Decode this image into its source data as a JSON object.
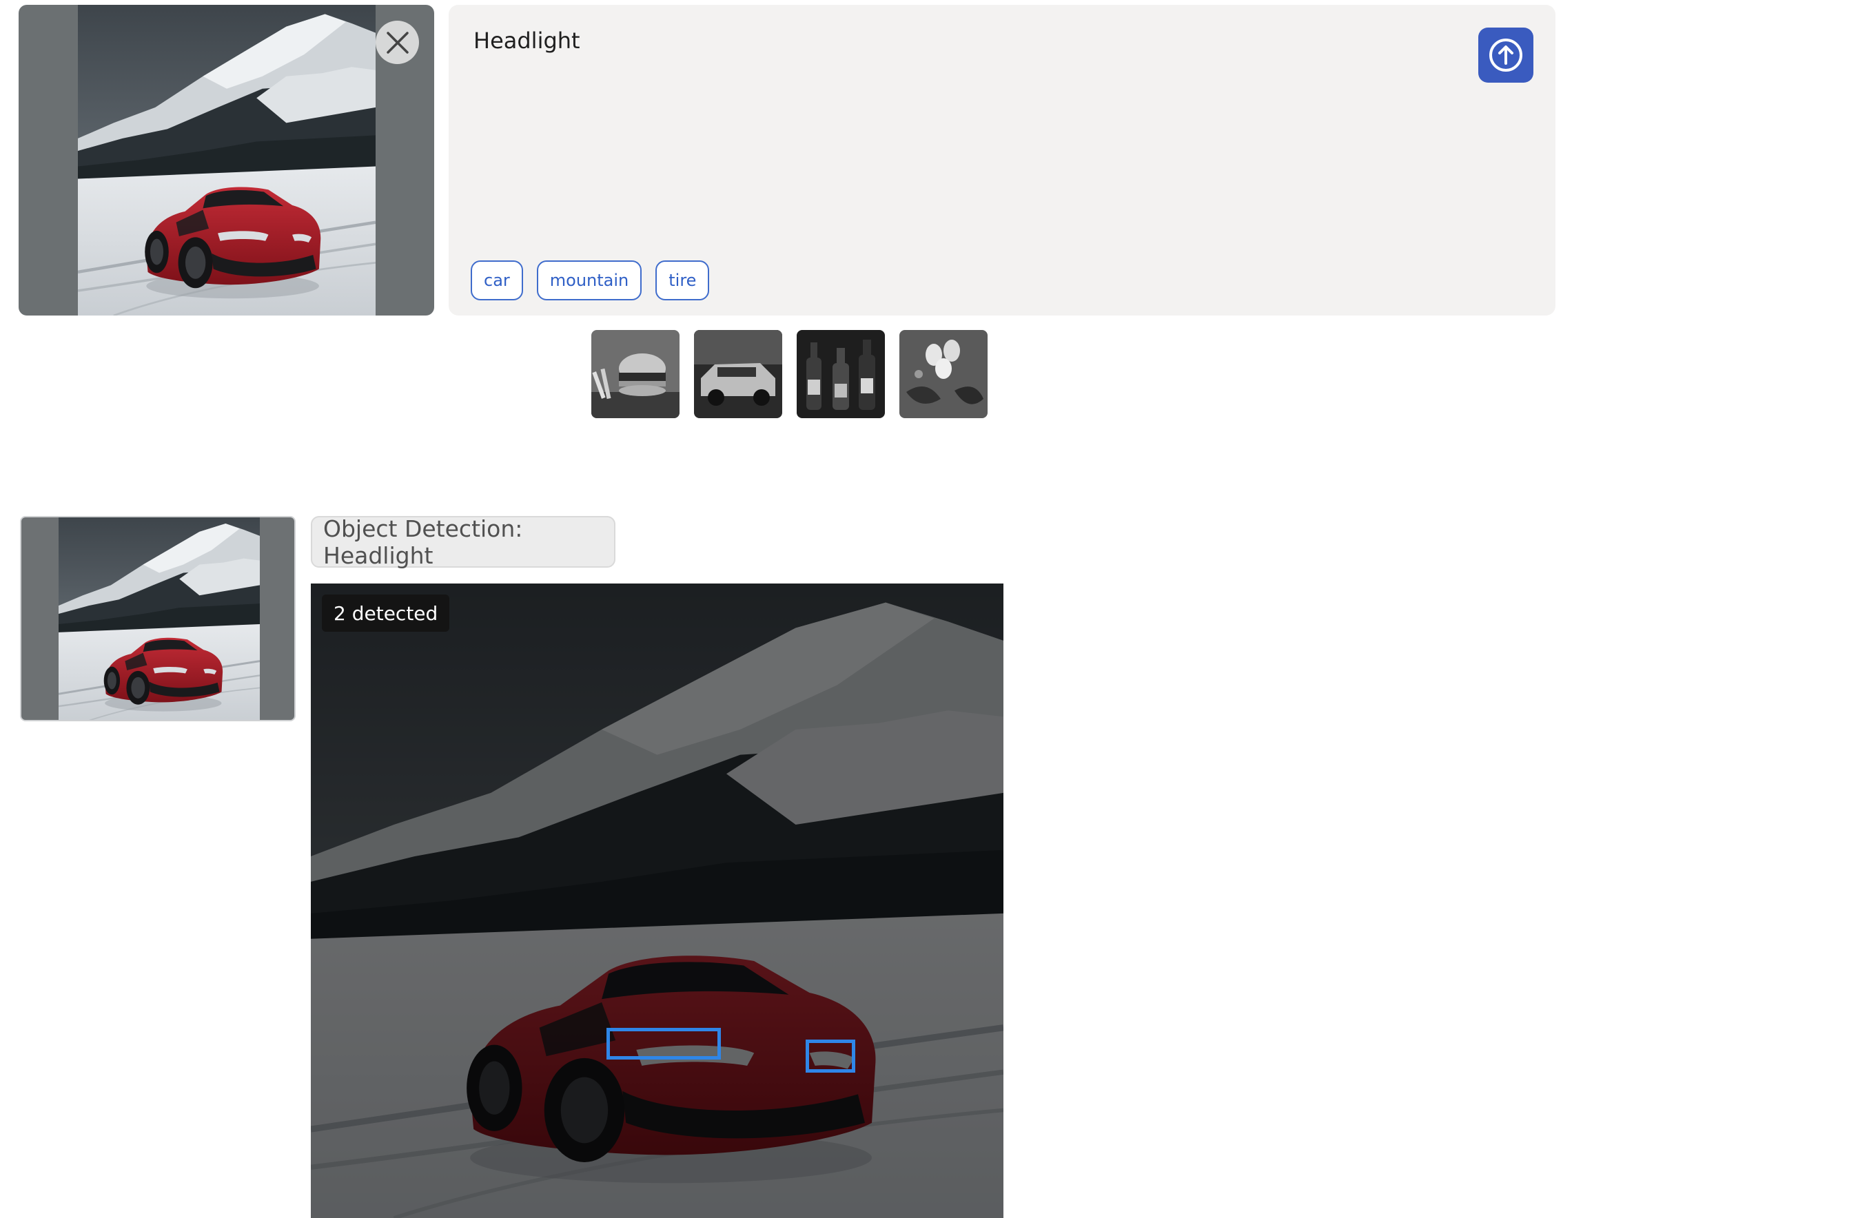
{
  "upload": {
    "image_alt": "red sports car on snowy mountain road",
    "close_icon": "close-icon"
  },
  "prompt": {
    "text": "Headlight",
    "submit_icon": "arrow-up-circle-icon",
    "chips": [
      "car",
      "mountain",
      "tire"
    ]
  },
  "examples": [
    {
      "name": "burger-and-fries"
    },
    {
      "name": "vintage-car"
    },
    {
      "name": "wine-bottles"
    },
    {
      "name": "eggs-and-peppers"
    }
  ],
  "result": {
    "task_label": "Object Detection: Headlight",
    "detected_label": "2 detected",
    "box_color": "#2f86e8",
    "detections": [
      {
        "label": "Headlight"
      },
      {
        "label": "Headlight"
      }
    ]
  },
  "colors": {
    "accent": "#3a5bbf",
    "chip": "#3f6ccc"
  }
}
